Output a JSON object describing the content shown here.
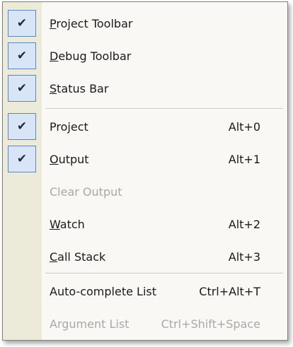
{
  "menu": {
    "items": [
      {
        "pre": "",
        "acc": "P",
        "post": "roject Toolbar",
        "shortcut": "",
        "checked": true,
        "enabled": true
      },
      {
        "pre": "",
        "acc": "D",
        "post": "ebug Toolbar",
        "shortcut": "",
        "checked": true,
        "enabled": true
      },
      {
        "pre": "",
        "acc": "S",
        "post": "tatus Bar",
        "shortcut": "",
        "checked": true,
        "enabled": true
      },
      {
        "pre": "Pro",
        "acc": "j",
        "post": "ect",
        "shortcut": "Alt+0",
        "checked": true,
        "enabled": true
      },
      {
        "pre": "",
        "acc": "O",
        "post": "utput",
        "shortcut": "Alt+1",
        "checked": true,
        "enabled": true
      },
      {
        "pre": "Clear Output",
        "acc": "",
        "post": "",
        "shortcut": "",
        "checked": false,
        "enabled": false
      },
      {
        "pre": "",
        "acc": "W",
        "post": "atch",
        "shortcut": "Alt+2",
        "checked": false,
        "enabled": true
      },
      {
        "pre": "",
        "acc": "C",
        "post": "all Stack",
        "shortcut": "Alt+3",
        "checked": false,
        "enabled": true
      },
      {
        "pre": "Auto-complete List",
        "acc": "",
        "post": "",
        "shortcut": "Ctrl+Alt+T",
        "checked": false,
        "enabled": true
      },
      {
        "pre": "Argument List",
        "acc": "",
        "post": "",
        "shortcut": "Ctrl+Shift+Space",
        "checked": false,
        "enabled": false
      }
    ],
    "check_glyph": "✔"
  }
}
